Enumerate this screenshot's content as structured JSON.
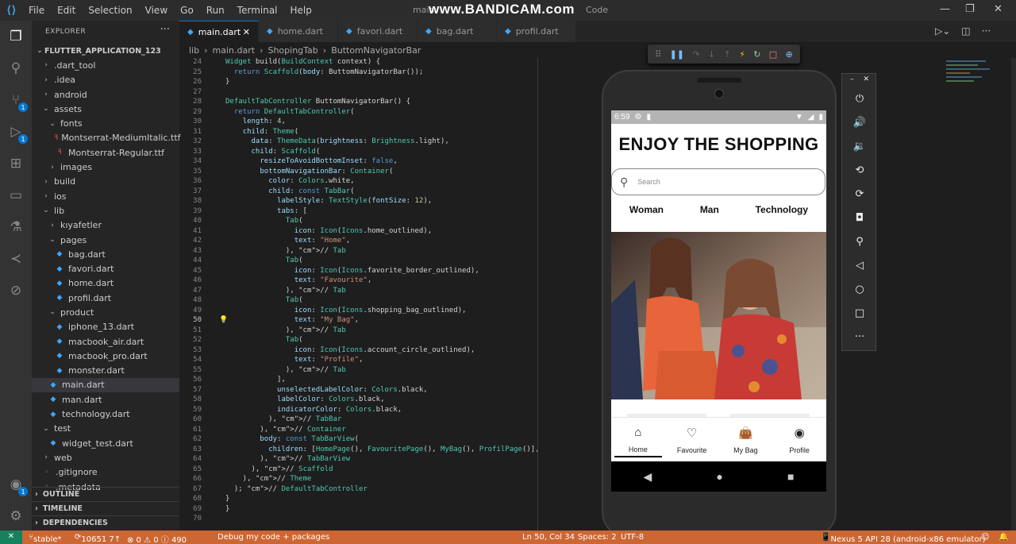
{
  "titlebar": {
    "menus": [
      "File",
      "Edit",
      "Selection",
      "View",
      "Go",
      "Run",
      "Terminal",
      "Help"
    ],
    "title_left": "main",
    "watermark": "www.BANDICAM.com",
    "title_right": "Code"
  },
  "explorer": {
    "header": "EXPLORER",
    "project": "FLUTTER_APPLICATION_123",
    "items": [
      {
        "label": ".dart_tool",
        "type": "folder",
        "depth": 1
      },
      {
        "label": ".idea",
        "type": "folder",
        "depth": 1
      },
      {
        "label": "android",
        "type": "folder",
        "depth": 1
      },
      {
        "label": "assets",
        "type": "folder-open",
        "depth": 1
      },
      {
        "label": "fonts",
        "type": "folder-open",
        "depth": 2
      },
      {
        "label": "Montserrat-MediumItalic.ttf",
        "type": "font",
        "depth": 3
      },
      {
        "label": "Montserrat-Regular.ttf",
        "type": "font",
        "depth": 3
      },
      {
        "label": "images",
        "type": "folder",
        "depth": 2
      },
      {
        "label": "build",
        "type": "folder",
        "depth": 1
      },
      {
        "label": "ios",
        "type": "folder",
        "depth": 1
      },
      {
        "label": "lib",
        "type": "folder-open",
        "depth": 1
      },
      {
        "label": "kıyafetler",
        "type": "folder",
        "depth": 2
      },
      {
        "label": "pages",
        "type": "folder-open",
        "depth": 2
      },
      {
        "label": "bag.dart",
        "type": "dart",
        "depth": 3
      },
      {
        "label": "favori.dart",
        "type": "dart",
        "depth": 3
      },
      {
        "label": "home.dart",
        "type": "dart",
        "depth": 3
      },
      {
        "label": "profil.dart",
        "type": "dart",
        "depth": 3
      },
      {
        "label": "product",
        "type": "folder-open",
        "depth": 2
      },
      {
        "label": "iphone_13.dart",
        "type": "dart",
        "depth": 3
      },
      {
        "label": "macbook_air.dart",
        "type": "dart",
        "depth": 3
      },
      {
        "label": "macbook_pro.dart",
        "type": "dart",
        "depth": 3
      },
      {
        "label": "monster.dart",
        "type": "dart",
        "depth": 3
      },
      {
        "label": "main.dart",
        "type": "dart",
        "depth": 2,
        "selected": true
      },
      {
        "label": "man.dart",
        "type": "dart",
        "depth": 2
      },
      {
        "label": "technology.dart",
        "type": "dart",
        "depth": 2
      },
      {
        "label": "test",
        "type": "folder-open",
        "depth": 1
      },
      {
        "label": "widget_test.dart",
        "type": "dart",
        "depth": 2
      },
      {
        "label": "web",
        "type": "folder",
        "depth": 1
      },
      {
        "label": ".gitignore",
        "type": "file",
        "depth": 1
      },
      {
        "label": ".metadata",
        "type": "file",
        "depth": 1
      }
    ],
    "sections": [
      "OUTLINE",
      "TIMELINE",
      "DEPENDENCIES"
    ]
  },
  "tabs": [
    {
      "label": "main.dart",
      "active": true
    },
    {
      "label": "home.dart",
      "active": false
    },
    {
      "label": "favori.dart",
      "active": false
    },
    {
      "label": "bag.dart",
      "active": false
    },
    {
      "label": "profil.dart",
      "active": false
    }
  ],
  "breadcrumb": [
    "lib",
    "main.dart",
    "ShopingTab",
    "ButtomNavigatorBar"
  ],
  "editor": {
    "current_line": "50",
    "lines": [
      [
        "24",
        "Widget build(BuildContext context) {"
      ],
      [
        "25",
        "  return Scaffold(body: ButtomNavigatorBar());"
      ],
      [
        "26",
        "}"
      ],
      [
        "27",
        ""
      ],
      [
        "28",
        "DefaultTabController ButtomNavigatorBar() {"
      ],
      [
        "29",
        "  return DefaultTabController("
      ],
      [
        "30",
        "    length: 4,"
      ],
      [
        "31",
        "    child: Theme("
      ],
      [
        "32",
        "      data: ThemeData(brightness: Brightness.light),"
      ],
      [
        "33",
        "      child: Scaffold("
      ],
      [
        "34",
        "        resizeToAvoidBottomInset: false,"
      ],
      [
        "35",
        "        bottomNavigationBar: Container("
      ],
      [
        "36",
        "          color: Colors.white,"
      ],
      [
        "37",
        "          child: const TabBar("
      ],
      [
        "38",
        "            labelStyle: TextStyle(fontSize: 12),"
      ],
      [
        "39",
        "            tabs: ["
      ],
      [
        "40",
        "              Tab("
      ],
      [
        "41",
        "                icon: Icon(Icons.home_outlined),"
      ],
      [
        "42",
        "                text: \"Home\","
      ],
      [
        "43",
        "              ), // Tab"
      ],
      [
        "44",
        "              Tab("
      ],
      [
        "45",
        "                icon: Icon(Icons.favorite_border_outlined),"
      ],
      [
        "46",
        "                text: \"Favourite\","
      ],
      [
        "47",
        "              ), // Tab"
      ],
      [
        "48",
        "              Tab("
      ],
      [
        "49",
        "                icon: Icon(Icons.shopping_bag_outlined),"
      ],
      [
        "50",
        "                text: \"My Bag\","
      ],
      [
        "51",
        "              ), // Tab"
      ],
      [
        "52",
        "              Tab("
      ],
      [
        "53",
        "                icon: Icon(Icons.account_circle_outlined),"
      ],
      [
        "54",
        "                text: \"Profile\","
      ],
      [
        "55",
        "              ), // Tab"
      ],
      [
        "56",
        "            ],"
      ],
      [
        "57",
        "            unselectedLabelColor: Colors.black,"
      ],
      [
        "58",
        "            labelColor: Colors.black,"
      ],
      [
        "59",
        "            indicatorColor: Colors.black,"
      ],
      [
        "60",
        "          ), // TabBar"
      ],
      [
        "61",
        "        ), // Container"
      ],
      [
        "62",
        "        body: const TabBarView("
      ],
      [
        "63",
        "          children: [HomePage(), FavouritePage(), MyBag(), ProfilPage()],"
      ],
      [
        "64",
        "        ), // TabBarView"
      ],
      [
        "65",
        "      ), // Scaffold"
      ],
      [
        "66",
        "    ), // Theme"
      ],
      [
        "67",
        "  ); // DefaultTabController"
      ],
      [
        "68",
        "}"
      ],
      [
        "69",
        "}"
      ],
      [
        "70",
        ""
      ]
    ]
  },
  "phone": {
    "time": "6:59",
    "app_title": "ENJOY THE SHOPPING",
    "search_placeholder": "Search",
    "top_tabs": [
      "Woman",
      "Man",
      "Technology"
    ],
    "bottom_nav": [
      {
        "label": "Home",
        "icon": "home-icon",
        "active": true
      },
      {
        "label": "Favourite",
        "icon": "heart-icon",
        "active": false
      },
      {
        "label": "My Bag",
        "icon": "bag-icon",
        "active": false
      },
      {
        "label": "Profile",
        "icon": "profile-icon",
        "active": false
      }
    ]
  },
  "statusline": {
    "branch": "stable*",
    "sync": "10651 7↑",
    "problems": "⊗ 0 ⚠ 0 ⓘ 490",
    "debug": "Debug my code + packages",
    "position": "Ln 50, Col 34",
    "spaces": "Spaces: 2",
    "encoding": "UTF-8",
    "device": "Nexus 5 API 28 (android-x86 emulator)"
  },
  "colors": {
    "accent": "#0078d4",
    "statusbar": "#cc6633",
    "editor_bg": "#1e1e1e"
  }
}
